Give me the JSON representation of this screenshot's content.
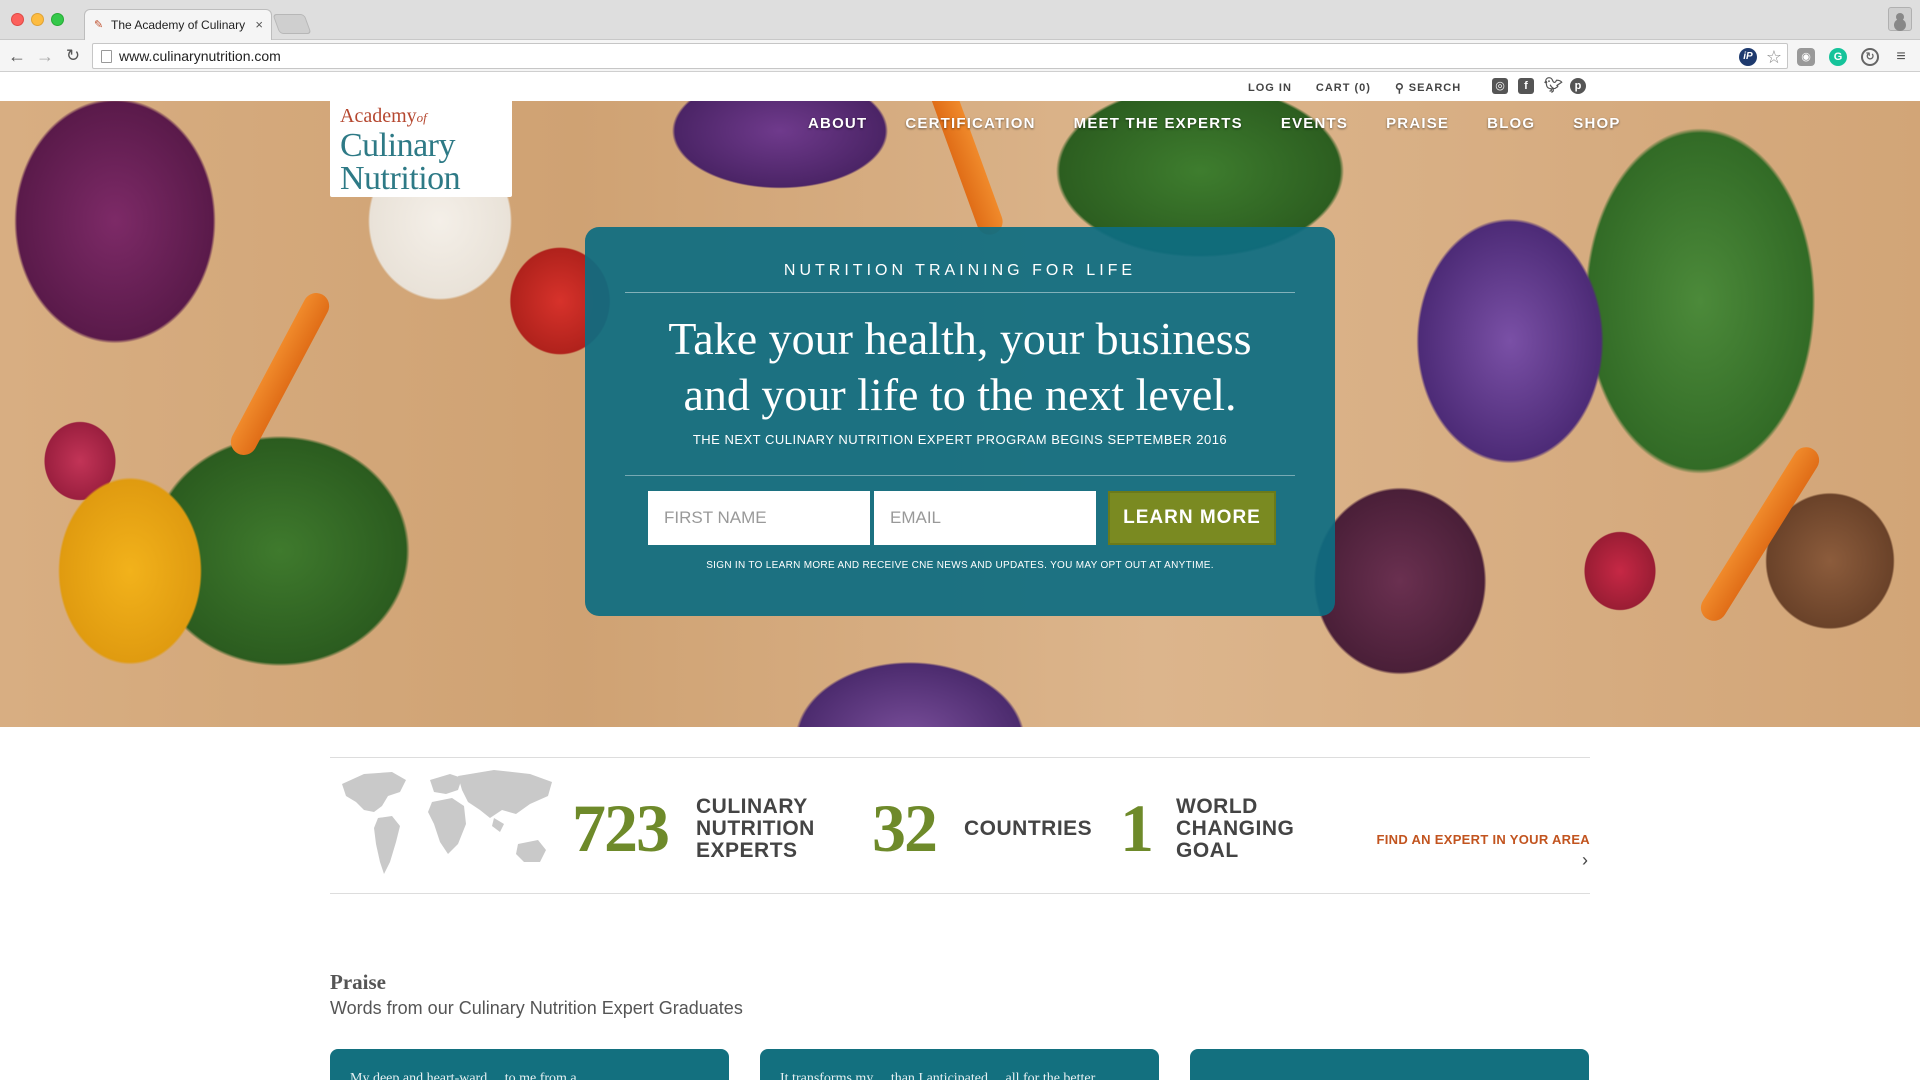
{
  "browser": {
    "tab_title": "The Academy of Culinary N",
    "url": "www.culinarynutrition.com"
  },
  "utility": {
    "login": "LOG IN",
    "cart": "CART (0)",
    "search": "SEARCH"
  },
  "logo": {
    "line1": "Academy",
    "line1_of": "of",
    "line2": "Culinary",
    "line3": "Nutrition"
  },
  "nav": [
    "ABOUT",
    "CERTIFICATION",
    "MEET THE EXPERTS",
    "EVENTS",
    "PRAISE",
    "BLOG",
    "SHOP"
  ],
  "promo": {
    "eyebrow": "NUTRITION TRAINING FOR LIFE",
    "headline_line1": "Take your health, your business",
    "headline_line2": "and your life to the next level.",
    "sub": "THE NEXT CULINARY NUTRITION EXPERT PROGRAM BEGINS SEPTEMBER 2016",
    "first_name_placeholder": "FIRST NAME",
    "email_placeholder": "EMAIL",
    "button": "LEARN MORE",
    "fine_print": "SIGN IN TO LEARN MORE AND RECEIVE CNE NEWS AND UPDATES. YOU MAY OPT OUT AT ANYTIME."
  },
  "stats": {
    "experts_num": "723",
    "experts_lbl": "CULINARY NUTRITION EXPERTS",
    "countries_num": "32",
    "countries_lbl": "COUNTRIES",
    "goal_num": "1",
    "goal_lbl": "WORLD CHANGING GOAL",
    "find_link": "FIND AN EXPERT IN YOUR AREA"
  },
  "praise": {
    "title": "Praise",
    "subtitle": "Words from our Culinary Nutrition Expert Graduates",
    "cards": [
      "My deep and heart-ward ... to me from a ...",
      "It transforms my ... than I anticipated ... all for the better",
      ""
    ]
  },
  "colors": {
    "teal": "#0e6d81",
    "olive": "#7a8a21",
    "stat_green": "#6e8a2a",
    "link_orange": "#c2541f"
  }
}
